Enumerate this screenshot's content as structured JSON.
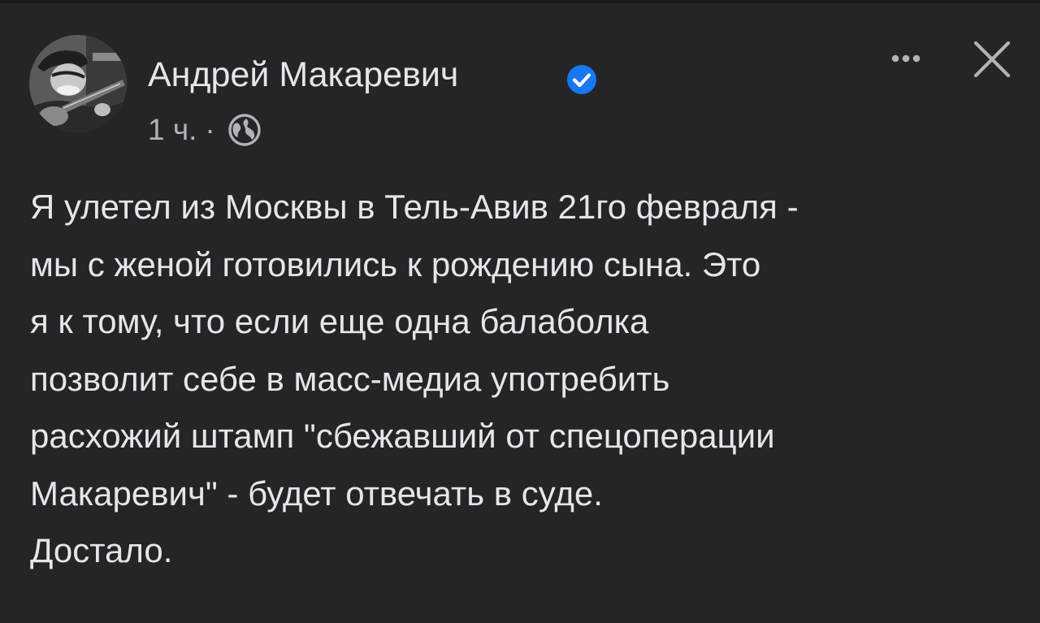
{
  "post": {
    "author": "Андрей Макаревич",
    "verified": true,
    "time": "1 ч.",
    "separator": "·",
    "audience_icon": "globe-icon",
    "lines": [
      "Я улетел из Москвы в Тель-Авив 21го февраля -",
      "мы с женой готовились к рождению сына. Это",
      "я к тому, что если еще одна балаболка",
      "позволит себе в масс-медиа употребить",
      "расхожий штамп \"сбежавший от спецоперации",
      "Макаревич\" - будет отвечать в суде.",
      "Достало."
    ]
  },
  "header": {
    "more_icon": "more-options-icon",
    "close_icon": "close-icon"
  },
  "colors": {
    "background": "#242526",
    "text": "#e4e6eb",
    "secondary_text": "#b0b3b8",
    "verified": "#1877f2"
  }
}
